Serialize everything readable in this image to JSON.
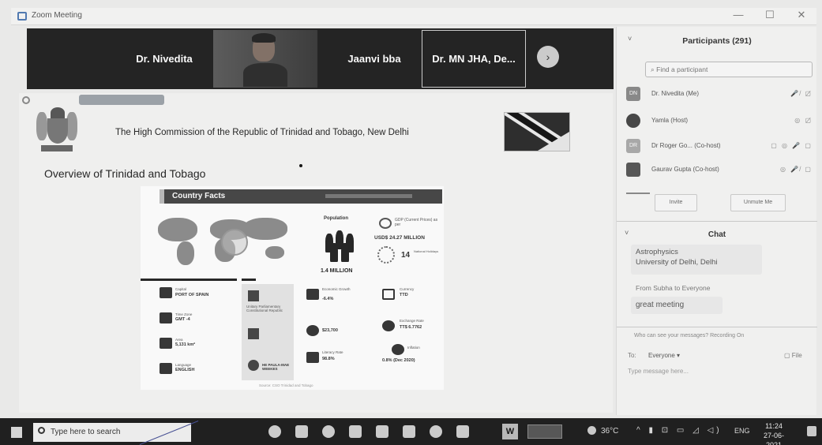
{
  "window": {
    "title": "Zoom Meeting",
    "controls": [
      "—",
      "☐",
      "✕"
    ]
  },
  "speakers": {
    "tile1": "Dr. Nivedita",
    "tile3": "Jaanvi bba",
    "tile4": "Dr. MN JHA, De...",
    "next": "›"
  },
  "slide": {
    "commission": "The High Commission of the Republic of Trinidad and Tobago, New Delhi",
    "overview": "Overview of Trinidad and Tobago",
    "infographic_title": "Country Facts",
    "population_label": "Population",
    "population_value": "1.4 MILLION",
    "gdp_label": "GDP (Current Prices) as per",
    "gdp_value": "USD$ 24.27 MILLION",
    "national_heritage_number": "14",
    "national_heritage_label": "National Holidays",
    "capital_label": "Capital",
    "capital_value": "PORT OF SPAIN",
    "timezone_label": "Time Zone",
    "timezone_value": "GMT -4",
    "area_label": "Area",
    "area_value": "5,131 km²",
    "language_label": "Language",
    "language_value": "ENGLISH",
    "gov_label": "Unitary Parliamentary Constitutional Republic",
    "president_label": "HE PAULA-MAE WEEKES",
    "growth_label": "Economic Growth",
    "growth_value": "-6.4%",
    "currency_label": "Currency",
    "currency_value": "TTD",
    "exchange_label": "Exchange Rate",
    "exchange_value": "TT$ 6.7762",
    "per_capita_value": "$23,700",
    "literacy_label": "Literacy Rate",
    "literacy_value": "98.8%",
    "inflation_label": "Inflation",
    "inflation_value": "0.8% (Dec 2020)",
    "source": "Source: CSO Trinidad and Tobago"
  },
  "participants": {
    "heading": "Participants (291)",
    "search_placeholder": "Find a participant",
    "list": [
      {
        "initials": "DN",
        "name": "Dr. Nivedita (Me)",
        "icons": "🎤̸ ▢̸"
      },
      {
        "initials": "",
        "name": "Yamla (Host)",
        "icons": "◎ ▢̸"
      },
      {
        "initials": "DR",
        "name": "Dr Roger Go...  (Co-host)",
        "icons": "▢ ◎ 🎤 ▢"
      },
      {
        "initials": "",
        "name": "Gaurav Gupta (Co-host)",
        "icons": "◎ 🎤̸ ▢"
      }
    ],
    "invite": "Invite",
    "unmute": "Unmute Me"
  },
  "chat": {
    "title": "Chat",
    "bubble1_line1": "Astrophysics",
    "bubble1_line2": "University of Delhi, Delhi",
    "from": "From Subha to Everyone",
    "bubble2": "great meeting",
    "who_note": "Who can see your messages? Recording On",
    "to_label": "To:",
    "to_value": "Everyone ▾",
    "file": "▢ File",
    "placeholder": "Type message here..."
  },
  "taskbar": {
    "search": "Type here to search",
    "word": "W",
    "weather": "36°C",
    "tray": "^ ▮ ⊡ ▭ ◿ ◁)",
    "lang": "ENG",
    "time": "11:24",
    "date": "27-06-2021"
  }
}
